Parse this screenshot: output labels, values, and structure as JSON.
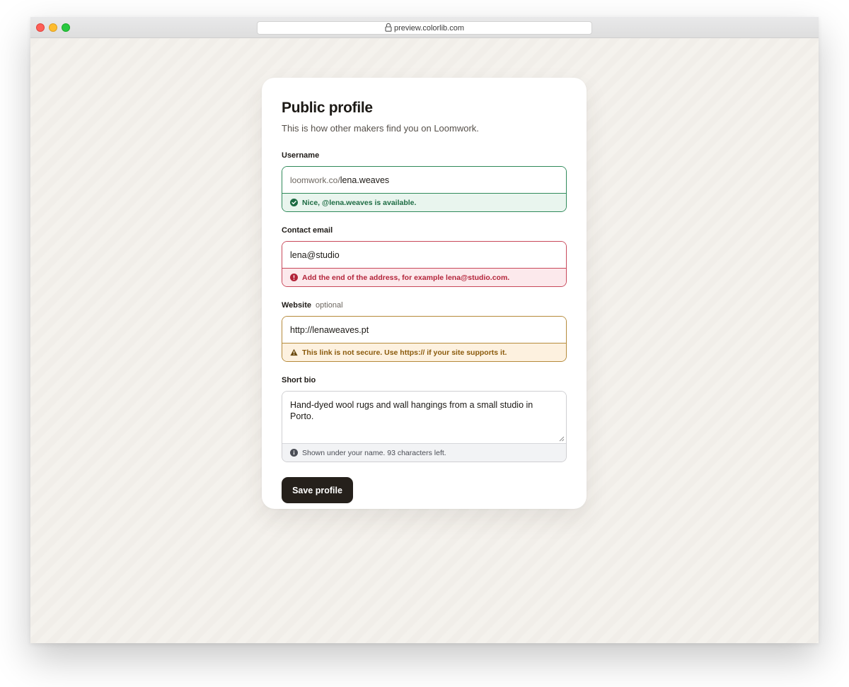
{
  "browser": {
    "url": "preview.colorlib.com"
  },
  "form": {
    "title": "Public profile",
    "subtitle": "This is how other makers find you on Loomwork.",
    "username": {
      "label": "Username",
      "prefix": "loomwork.co/",
      "value": "lena.weaves",
      "message": "Nice, @lena.weaves is available.",
      "status": "success",
      "icon": "check-circle-icon"
    },
    "email": {
      "label": "Contact email",
      "value": "lena@studio",
      "message": "Add the end of the address, for example lena@studio.com.",
      "status": "error",
      "icon": "alert-circle-icon"
    },
    "website": {
      "label": "Website",
      "optional_label": "optional",
      "value": "http://lenaweaves.pt",
      "message": "This link is not secure. Use https:// if your site supports it.",
      "status": "warning",
      "icon": "warning-triangle-icon"
    },
    "bio": {
      "label": "Short bio",
      "value": "Hand-dyed wool rugs and wall hangings from a small studio in Porto.",
      "message": "Shown under your name. 93 characters left.",
      "status": "info",
      "icon": "info-circle-icon"
    },
    "save_label": "Save profile"
  },
  "colors": {
    "success": "#2f8a5a",
    "error": "#c8485a",
    "warning": "#b58a3a",
    "button": "#25201b",
    "page_background": "#f4f1ec"
  }
}
